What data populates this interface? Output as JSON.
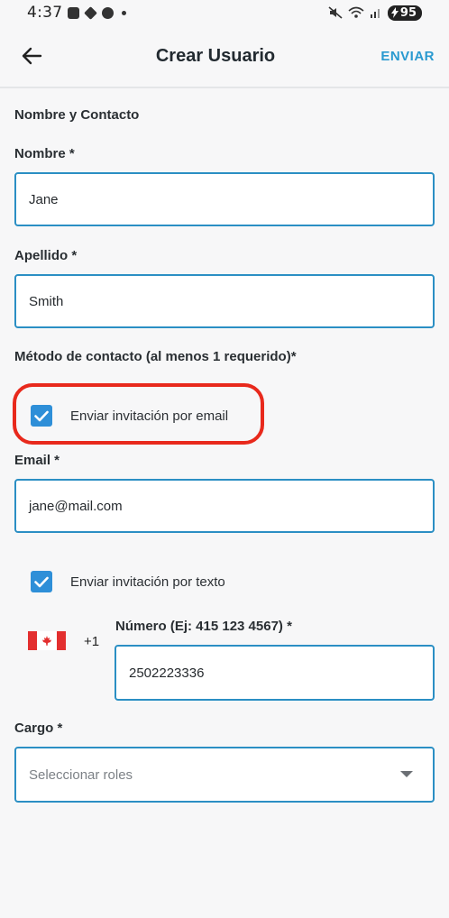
{
  "status_bar": {
    "time": "4:37",
    "battery": "95"
  },
  "header": {
    "title": "Crear Usuario",
    "send_label": "ENVIAR"
  },
  "form": {
    "section_title": "Nombre y Contacto",
    "first_name": {
      "label": "Nombre *",
      "value": "Jane"
    },
    "last_name": {
      "label": "Apellido *",
      "value": "Smith"
    },
    "contact_method_label": "Método de contacto (al menos 1 requerido)*",
    "invite_email": {
      "label": "Enviar invitación por email",
      "checked": true
    },
    "email": {
      "label": "Email *",
      "value": "jane@mail.com"
    },
    "invite_text": {
      "label": "Enviar invitación por texto",
      "checked": true
    },
    "phone": {
      "dial_code": "+1",
      "label": "Número (Ej: 415 123 4567) *",
      "value": "2502223336"
    },
    "role": {
      "label": "Cargo *",
      "placeholder": "Seleccionar roles"
    }
  },
  "colors": {
    "accent": "#2a9ad0",
    "field_border": "#2b8fc4",
    "checkbox": "#2e8fd8",
    "highlight": "#e8291c"
  }
}
